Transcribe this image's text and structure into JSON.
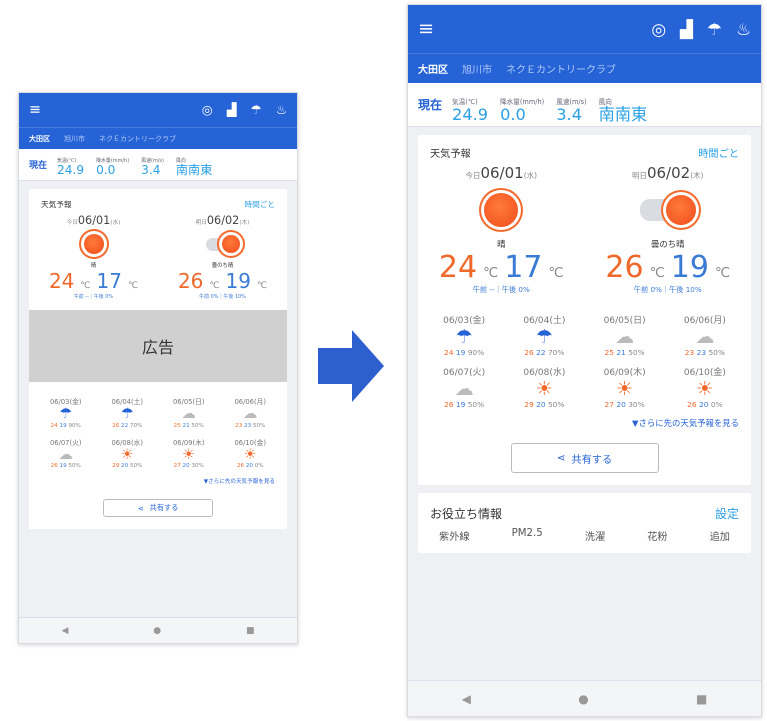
{
  "header": {
    "menu_icon": "hamburger-icon",
    "action_icons": [
      "typhoon-icon",
      "chart-icon",
      "weather-alert-icon",
      "notification-icon"
    ]
  },
  "tabs": [
    {
      "label": "大田区",
      "active": true
    },
    {
      "label": "旭川市",
      "active": false
    },
    {
      "label": "ネクＥカントリークラブ",
      "active": false
    }
  ],
  "current": {
    "label": "現在",
    "temp_label": "気温(℃)",
    "temp": "24.9",
    "rain_label": "降水量(mm/h)",
    "rain": "0.0",
    "wind_label": "風速(m/s)",
    "wind": "3.4",
    "dir_label": "風向",
    "dir": "南南東"
  },
  "forecast": {
    "title": "天気予報",
    "link": "時間ごと",
    "days": [
      {
        "prefix": "今日",
        "date": "06/01",
        "suffix": "(水)",
        "icon": "sunny-icon",
        "weather": "晴",
        "hi": "24",
        "lo": "17",
        "rain": "午前 --｜午後 0%"
      },
      {
        "prefix": "明日",
        "date": "06/02",
        "suffix": "(木)",
        "icon": "cloudy-then-sunny-icon",
        "weather": "曇のち晴",
        "hi": "26",
        "lo": "19",
        "rain": "午前 0%｜午後 10%"
      }
    ],
    "ad_label": "広告",
    "week": [
      {
        "date": "06/03(金)",
        "icon": "rain-icon",
        "hi": "24",
        "lo": "19",
        "pop": "90%"
      },
      {
        "date": "06/04(土)",
        "icon": "rain-icon",
        "hi": "26",
        "lo": "22",
        "pop": "70%"
      },
      {
        "date": "06/05(日)",
        "icon": "cloud-icon",
        "hi": "25",
        "lo": "21",
        "pop": "50%"
      },
      {
        "date": "06/06(月)",
        "icon": "cloud-icon",
        "hi": "23",
        "lo": "23",
        "pop": "50%"
      },
      {
        "date": "06/07(火)",
        "icon": "cloud-icon",
        "hi": "26",
        "lo": "19",
        "pop": "50%"
      },
      {
        "date": "06/08(水)",
        "icon": "sun-cloud-icon",
        "hi": "29",
        "lo": "20",
        "pop": "50%"
      },
      {
        "date": "06/09(木)",
        "icon": "sun-cloud-icon",
        "hi": "27",
        "lo": "20",
        "pop": "30%"
      },
      {
        "date": "06/10(金)",
        "icon": "sunny-icon",
        "hi": "26",
        "lo": "20",
        "pop": "0%"
      }
    ],
    "more_link": "▼さらに先の天気予報を見る",
    "share_label": "共有する"
  },
  "useful": {
    "title": "お役立ち情報",
    "link": "設定",
    "items": [
      "紫外線",
      "PM2.5",
      "洗濯",
      "花粉",
      "追加"
    ]
  },
  "nav": [
    "◀",
    "●",
    "■"
  ],
  "colors": {
    "primary": "#2663d6",
    "accent": "#2aa0e6",
    "hot": "#f0682a",
    "cold": "#3a7bd5"
  }
}
